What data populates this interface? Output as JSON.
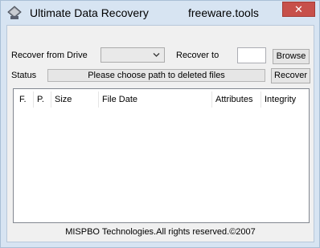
{
  "titlebar": {
    "title": "Ultimate Data Recovery",
    "subtitle": "freeware.tools",
    "close_glyph": "✕",
    "icon": "app-drive-icon",
    "close_color": "#c7504a"
  },
  "form": {
    "recover_from_label": "Recover from Drive",
    "drive_selected": "",
    "recover_to_label": "Recover to",
    "recover_to_value": "",
    "browse_label": "Browse",
    "status_label": "Status",
    "status_text": "Please choose path to deleted files",
    "recover_label": "Recover"
  },
  "list": {
    "columns": [
      "F.",
      "P.",
      "Size",
      "File Date",
      "Attributes",
      "Integrity"
    ],
    "rows": []
  },
  "footer": {
    "copyright": "MISPBO Technologies.All rights reserved.©2007"
  }
}
